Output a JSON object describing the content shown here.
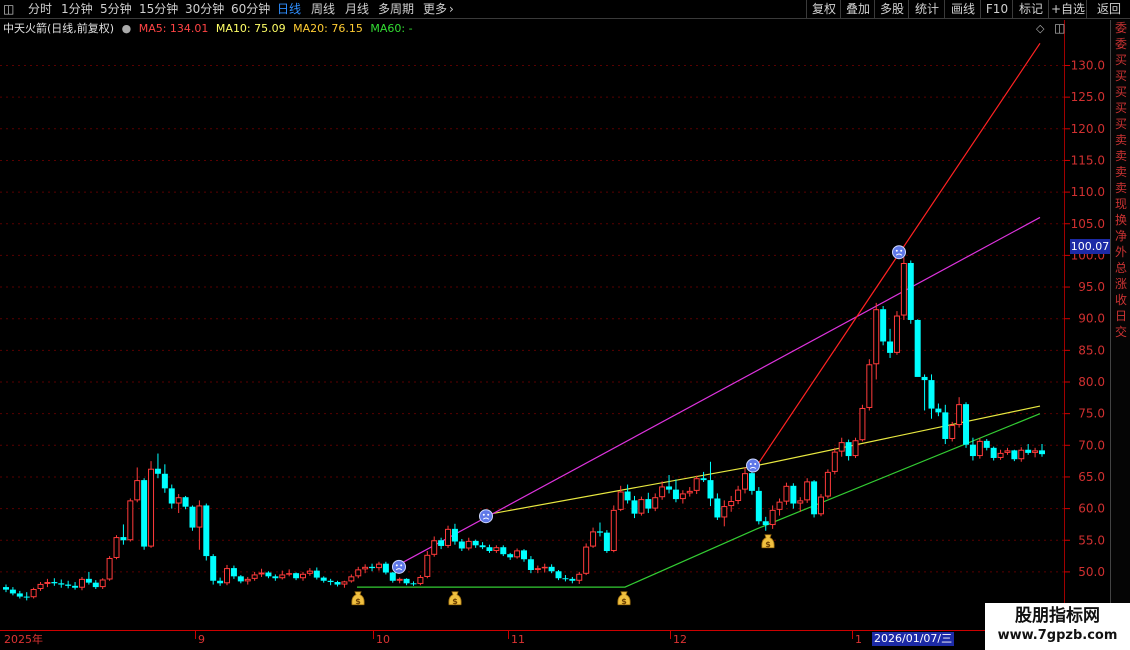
{
  "toolbar": {
    "tabs": [
      "分时",
      "1分钟",
      "5分钟",
      "15分钟",
      "30分钟",
      "60分钟",
      "日线",
      "周线",
      "月线",
      "多周期",
      "更多"
    ],
    "active_tab": "日线",
    "more_arrow": "›",
    "right_buttons": [
      "复权",
      "叠加",
      "多股",
      "统计",
      "画线",
      "F10",
      "标记",
      "+自选",
      "返回"
    ]
  },
  "info": {
    "stock": "中天火箭(日线,前复权)",
    "ma5": "MA5: 134.01",
    "ma10": "MA10: 75.09",
    "ma20": "MA20: 76.15",
    "ma60": "MA60: -"
  },
  "colors": {
    "up": "#ff3b3b",
    "down": "#00ffff",
    "ma5": "#ffffff",
    "ma10": "#ffff66",
    "ma20": "#ff33ff",
    "grid": "#5a0000",
    "axis_text": "#d03030",
    "green_line": "#33cc33",
    "magenta_line": "#dd33dd",
    "red_line": "#ff2222",
    "yellow_line": "#e8e840",
    "active_tab": "#2f8fff"
  },
  "right_panel_chars": [
    "委",
    "委",
    "买",
    "买",
    "买",
    "买",
    "买",
    "卖",
    "卖",
    "卖",
    "卖",
    "现",
    "换",
    "净",
    "外",
    "总",
    "涨",
    "收",
    "日",
    "交"
  ],
  "price_tag": "100.07",
  "chart_data": {
    "type": "candlestick",
    "y_ticks": [
      "130.0",
      "125.0",
      "120.0",
      "115.0",
      "110.0",
      "105.0",
      "100.0",
      "95.0",
      "90.0",
      "85.0",
      "80.0",
      "75.0",
      "70.0",
      "65.0",
      "60.0",
      "55.0",
      "50.0"
    ],
    "ylim": [
      45,
      135
    ],
    "x_labels": [
      "2025年",
      "9",
      "10",
      "11",
      "12",
      "1"
    ],
    "active_date": "2026/01/07/三",
    "candles": [
      [
        47.6,
        48.0,
        46.8,
        47.2
      ],
      [
        47.2,
        47.6,
        46.3,
        46.6
      ],
      [
        46.6,
        47.0,
        45.8,
        46.1
      ],
      [
        46.1,
        46.8,
        45.5,
        46.0
      ],
      [
        46.0,
        47.5,
        45.8,
        47.3
      ],
      [
        47.3,
        48.4,
        47.0,
        48.1
      ],
      [
        48.1,
        48.9,
        47.6,
        48.4
      ],
      [
        48.4,
        49.0,
        47.8,
        48.2
      ],
      [
        48.2,
        48.8,
        47.5,
        48.0
      ],
      [
        48.0,
        48.6,
        47.4,
        47.8
      ],
      [
        47.8,
        48.4,
        47.2,
        47.5
      ],
      [
        47.5,
        49.2,
        47.1,
        48.9
      ],
      [
        48.9,
        50.0,
        48.0,
        48.3
      ],
      [
        48.3,
        48.7,
        47.3,
        47.6
      ],
      [
        47.6,
        49.0,
        47.3,
        48.8
      ],
      [
        48.8,
        52.5,
        48.6,
        52.2
      ],
      [
        52.2,
        55.8,
        52.0,
        55.5
      ],
      [
        55.5,
        57.5,
        54.3,
        55.0
      ],
      [
        55.0,
        61.6,
        54.8,
        61.3
      ],
      [
        61.3,
        66.5,
        61.0,
        64.5
      ],
      [
        64.5,
        64.8,
        53.5,
        54.0
      ],
      [
        54.0,
        67.5,
        53.8,
        66.3
      ],
      [
        66.3,
        68.7,
        64.8,
        65.5
      ],
      [
        65.5,
        67.0,
        62.5,
        63.2
      ],
      [
        63.2,
        63.8,
        60.0,
        60.8
      ],
      [
        60.8,
        62.3,
        59.3,
        61.8
      ],
      [
        61.8,
        62.0,
        59.9,
        60.3
      ],
      [
        60.3,
        60.5,
        56.5,
        57.0
      ],
      [
        57.0,
        61.3,
        53.5,
        60.5
      ],
      [
        60.5,
        60.8,
        51.8,
        52.5
      ],
      [
        52.5,
        52.8,
        48.0,
        48.6
      ],
      [
        48.6,
        49.1,
        47.8,
        48.2
      ],
      [
        48.2,
        51.1,
        47.9,
        50.6
      ],
      [
        50.6,
        51.0,
        48.9,
        49.3
      ],
      [
        49.3,
        49.5,
        48.2,
        48.5
      ],
      [
        48.5,
        49.2,
        48.0,
        48.9
      ],
      [
        48.9,
        50.0,
        48.6,
        49.6
      ],
      [
        49.6,
        50.5,
        49.2,
        49.9
      ],
      [
        49.9,
        50.1,
        49.0,
        49.3
      ],
      [
        49.3,
        49.6,
        48.6,
        49.0
      ],
      [
        49.0,
        50.2,
        48.8,
        49.6
      ],
      [
        49.6,
        50.4,
        49.3,
        49.8
      ],
      [
        49.8,
        49.9,
        48.7,
        49.0
      ],
      [
        49.0,
        50.0,
        48.6,
        49.7
      ],
      [
        49.7,
        50.6,
        49.4,
        50.2
      ],
      [
        50.2,
        50.7,
        48.8,
        49.1
      ],
      [
        49.1,
        49.3,
        48.3,
        48.6
      ],
      [
        48.6,
        48.9,
        47.9,
        48.4
      ],
      [
        48.4,
        48.6,
        47.7,
        48.0
      ],
      [
        48.0,
        48.6,
        47.5,
        48.5
      ],
      [
        48.5,
        49.6,
        48.3,
        49.3
      ],
      [
        49.3,
        50.8,
        49.0,
        50.4
      ],
      [
        50.4,
        51.2,
        49.8,
        50.8
      ],
      [
        50.8,
        51.3,
        50.1,
        50.6
      ],
      [
        50.6,
        51.6,
        50.2,
        51.3
      ],
      [
        51.3,
        51.6,
        49.6,
        49.9
      ],
      [
        49.9,
        50.0,
        48.3,
        48.6
      ],
      [
        48.6,
        49.1,
        48.2,
        48.9
      ],
      [
        48.9,
        49.0,
        47.9,
        48.2
      ],
      [
        48.2,
        48.5,
        47.8,
        48.1
      ],
      [
        48.1,
        49.5,
        47.9,
        49.2
      ],
      [
        49.2,
        53.3,
        49.0,
        52.7
      ],
      [
        52.7,
        55.6,
        52.4,
        55.0
      ],
      [
        55.0,
        55.4,
        53.6,
        54.1
      ],
      [
        54.1,
        57.3,
        53.8,
        56.8
      ],
      [
        56.8,
        57.6,
        54.3,
        54.8
      ],
      [
        54.8,
        55.2,
        53.3,
        53.7
      ],
      [
        53.7,
        55.4,
        53.4,
        54.9
      ],
      [
        54.9,
        55.1,
        53.8,
        54.2
      ],
      [
        54.2,
        54.7,
        53.6,
        53.9
      ],
      [
        53.9,
        54.3,
        53.0,
        53.3
      ],
      [
        53.3,
        54.2,
        53.0,
        53.9
      ],
      [
        53.9,
        54.2,
        52.5,
        52.8
      ],
      [
        52.8,
        53.0,
        51.9,
        52.3
      ],
      [
        52.3,
        53.7,
        52.1,
        53.4
      ],
      [
        53.4,
        53.6,
        51.6,
        52.0
      ],
      [
        52.0,
        52.5,
        49.8,
        50.3
      ],
      [
        50.3,
        51.0,
        49.8,
        50.6
      ],
      [
        50.6,
        51.3,
        49.9,
        50.8
      ],
      [
        50.8,
        51.2,
        49.8,
        50.1
      ],
      [
        50.1,
        50.3,
        48.7,
        49.0
      ],
      [
        49.0,
        49.5,
        48.5,
        48.9
      ],
      [
        48.9,
        49.2,
        48.2,
        48.6
      ],
      [
        48.6,
        50.0,
        48.1,
        49.7
      ],
      [
        49.7,
        54.5,
        49.5,
        54.0
      ],
      [
        54.0,
        57.0,
        53.8,
        56.4
      ],
      [
        56.4,
        57.8,
        55.6,
        56.2
      ],
      [
        56.2,
        56.6,
        53.0,
        53.3
      ],
      [
        53.3,
        60.5,
        53.1,
        59.8
      ],
      [
        59.8,
        63.6,
        59.6,
        62.7
      ],
      [
        62.7,
        63.8,
        60.8,
        61.3
      ],
      [
        61.3,
        62.0,
        58.5,
        59.2
      ],
      [
        59.2,
        61.9,
        58.9,
        61.5
      ],
      [
        61.5,
        62.5,
        59.3,
        60.0
      ],
      [
        60.0,
        62.4,
        59.6,
        61.8
      ],
      [
        61.8,
        64.3,
        61.4,
        63.5
      ],
      [
        63.5,
        65.3,
        62.4,
        63.0
      ],
      [
        63.0,
        64.6,
        61.0,
        61.5
      ],
      [
        61.5,
        62.9,
        60.8,
        62.4
      ],
      [
        62.4,
        63.4,
        61.9,
        62.8
      ],
      [
        62.8,
        65.2,
        62.3,
        64.8
      ],
      [
        64.8,
        65.8,
        64.2,
        64.5
      ],
      [
        64.5,
        67.4,
        60.4,
        61.6
      ],
      [
        61.6,
        62.4,
        58.2,
        58.6
      ],
      [
        58.6,
        61.3,
        57.2,
        60.4
      ],
      [
        60.4,
        62.0,
        59.5,
        61.2
      ],
      [
        61.2,
        63.6,
        60.7,
        63.0
      ],
      [
        63.0,
        66.5,
        62.4,
        65.6
      ],
      [
        65.6,
        66.0,
        62.2,
        62.8
      ],
      [
        62.8,
        63.4,
        57.5,
        58.0
      ],
      [
        58.0,
        58.7,
        56.5,
        57.4
      ],
      [
        57.4,
        60.5,
        56.8,
        59.8
      ],
      [
        59.8,
        61.6,
        58.9,
        61.1
      ],
      [
        61.1,
        64.1,
        60.6,
        63.6
      ],
      [
        63.6,
        64.0,
        60.0,
        60.8
      ],
      [
        60.8,
        61.8,
        59.5,
        61.3
      ],
      [
        61.3,
        64.8,
        60.9,
        64.3
      ],
      [
        64.3,
        64.5,
        58.6,
        59.1
      ],
      [
        59.1,
        62.3,
        58.8,
        61.9
      ],
      [
        61.9,
        66.2,
        61.6,
        65.8
      ],
      [
        65.8,
        69.6,
        65.4,
        69.0
      ],
      [
        69.0,
        71.2,
        68.2,
        70.5
      ],
      [
        70.5,
        70.9,
        67.6,
        68.3
      ],
      [
        68.3,
        71.2,
        68.0,
        70.8
      ],
      [
        70.8,
        76.4,
        70.6,
        75.9
      ],
      [
        75.9,
        83.6,
        75.5,
        82.8
      ],
      [
        82.8,
        92.5,
        80.4,
        91.5
      ],
      [
        91.5,
        92.0,
        85.8,
        86.4
      ],
      [
        86.4,
        88.4,
        83.8,
        84.6
      ],
      [
        84.6,
        91.2,
        84.3,
        90.5
      ],
      [
        90.5,
        99.7,
        89.8,
        98.8
      ],
      [
        98.8,
        99.2,
        89.2,
        89.8
      ],
      [
        89.8,
        89.9,
        86.8,
        80.8
      ],
      [
        80.8,
        81.2,
        75.5,
        80.3
      ],
      [
        80.3,
        81.2,
        74.2,
        75.8
      ],
      [
        75.8,
        76.6,
        74.6,
        75.2
      ],
      [
        75.2,
        76.4,
        70.2,
        71.0
      ],
      [
        71.0,
        73.7,
        70.6,
        73.2
      ],
      [
        73.2,
        77.6,
        72.8,
        76.5
      ],
      [
        76.5,
        76.8,
        69.6,
        70.1
      ],
      [
        70.1,
        71.2,
        67.6,
        68.3
      ],
      [
        68.3,
        71.1,
        67.9,
        70.7
      ],
      [
        70.7,
        71.0,
        69.2,
        69.6
      ],
      [
        69.6,
        69.8,
        67.6,
        68.0
      ],
      [
        68.0,
        69.3,
        67.7,
        68.8
      ],
      [
        68.8,
        69.6,
        68.5,
        69.2
      ],
      [
        69.2,
        69.3,
        67.5,
        67.8
      ],
      [
        67.8,
        69.7,
        67.4,
        69.3
      ],
      [
        69.3,
        70.2,
        68.5,
        68.8
      ],
      [
        68.8,
        69.6,
        68.1,
        69.2
      ],
      [
        69.2,
        70.2,
        68.2,
        68.6
      ]
    ],
    "red_line": [
      [
        757,
        66.8
      ],
      [
        1040,
        133.5
      ]
    ],
    "magenta_line": [
      [
        397,
        51.0
      ],
      [
        1040,
        106.0
      ]
    ],
    "yellow_line": [
      [
        485,
        59.0
      ],
      [
        757,
        66.8
      ],
      [
        1040,
        76.2
      ]
    ],
    "green_line": [
      [
        357,
        47.6
      ],
      [
        625,
        47.6
      ],
      [
        757,
        56.8
      ],
      [
        1040,
        75.0
      ]
    ],
    "sad_markers": [
      [
        399,
        50.8
      ],
      [
        486,
        58.8
      ],
      [
        753,
        66.8
      ],
      [
        899,
        100.5
      ]
    ],
    "money_markers": [
      [
        358,
        45.6
      ],
      [
        455,
        45.6
      ],
      [
        624,
        45.6
      ],
      [
        768,
        54.6
      ]
    ]
  },
  "watermark": {
    "line1": "股朋指标网",
    "line2": "www.7gpzb.com"
  }
}
